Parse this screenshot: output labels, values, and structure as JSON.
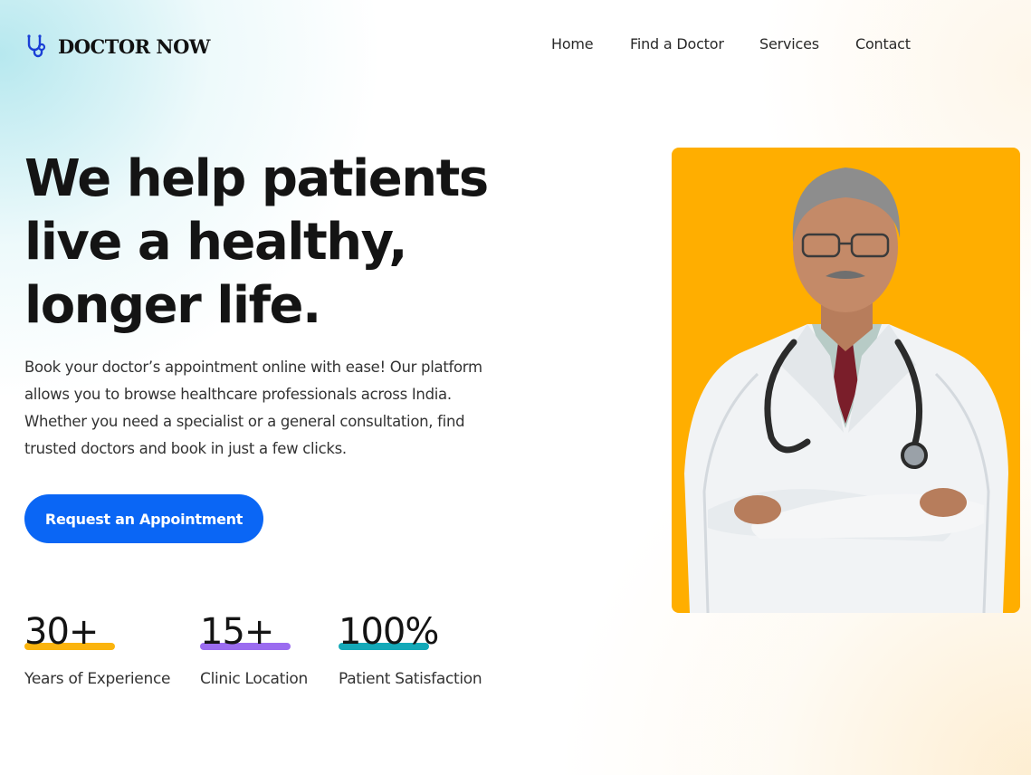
{
  "brand": {
    "name": "DOCTOR NOW",
    "icon": "stethoscope-icon",
    "color": "#1a3fd6"
  },
  "nav": {
    "items": [
      "Home",
      "Find a Doctor",
      "Services",
      "Contact"
    ]
  },
  "hero": {
    "title_lines": [
      "We help patients",
      "live a healthy,",
      "longer life."
    ],
    "description": "Book your doctor’s appointment online with ease! Our platform allows you to browse healthcare professionals across India. Whether you need a specialist or a general consultation, find trusted doctors and book in just a few clicks.",
    "cta_label": "Request an Appointment",
    "cta_color": "#0a66f5"
  },
  "stats": [
    {
      "value": "30+",
      "label": "Years of Experience",
      "accent": "#fbb40e"
    },
    {
      "value": "15+",
      "label": "Clinic Location",
      "accent": "#9b6cf0"
    },
    {
      "value": "100%",
      "label": "Patient Satisfaction",
      "accent": "#14a9b8"
    }
  ],
  "doctor_image": {
    "background": "#ffae00",
    "subject": "doctor-photo"
  }
}
